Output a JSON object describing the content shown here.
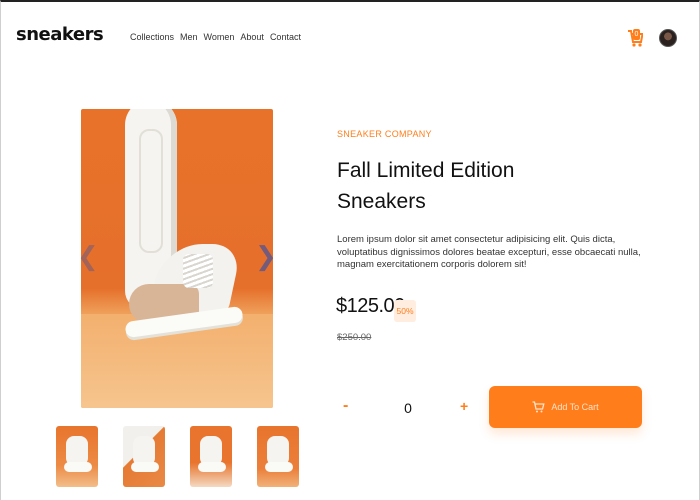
{
  "header": {
    "logo": "sneakers",
    "nav": [
      "Collections",
      "Men",
      "Women",
      "About",
      "Contact"
    ],
    "cart_count": "0"
  },
  "gallery": {
    "main_image": "sneaker-photo",
    "thumbnails": [
      "thumbnail-1",
      "thumbnail-2",
      "thumbnail-3",
      "thumbnail-4"
    ]
  },
  "product": {
    "company": "SNEAKER COMPANY",
    "title_line1": "Fall Limited Edition",
    "title_line2": "Sneakers",
    "description": "Lorem ipsum dolor sit amet consectetur adipisicing elit. Quis dicta, voluptatibus dignissimos dolores beatae excepturi, esse obcaecati nulla, magnam exercitationem corporis dolorem sit!",
    "price": "$125.00",
    "discount": "50%",
    "old_price": "$250.00"
  },
  "cart_controls": {
    "minus": "-",
    "quantity": "0",
    "plus": "+",
    "add_label": "Add To Cart"
  },
  "colors": {
    "accent": "#ff7e1b",
    "accent_light": "#ffede0",
    "text": "#1d2026"
  }
}
